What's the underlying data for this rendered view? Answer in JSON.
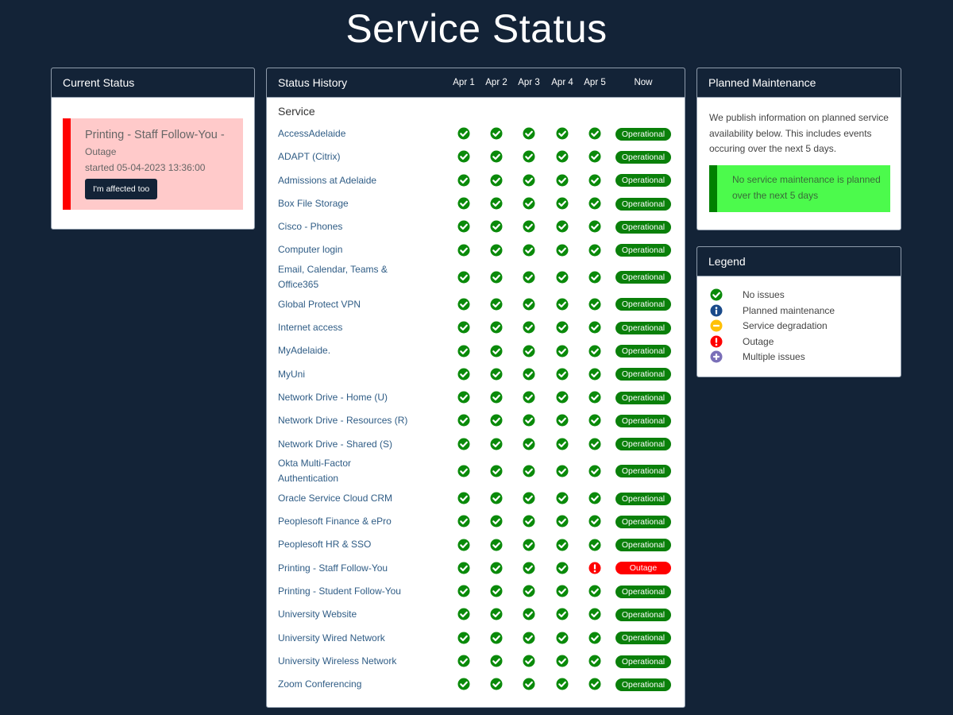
{
  "page": {
    "title": "Service Status"
  },
  "current_status": {
    "header": "Current Status",
    "incident": {
      "title": "Printing - Staff Follow-You -",
      "status": "Outage",
      "started": "started 05-04-2023 13:36:00",
      "button_label": "I'm affected too"
    }
  },
  "history": {
    "header": "Status History",
    "service_label": "Service",
    "columns": [
      "Apr 1",
      "Apr 2",
      "Apr 3",
      "Apr 4",
      "Apr 5"
    ],
    "now_label": "Now",
    "services": [
      {
        "name": "AccessAdelaide",
        "days": [
          "ok",
          "ok",
          "ok",
          "ok",
          "ok"
        ],
        "now": "Operational"
      },
      {
        "name": "ADAPT (Citrix)",
        "days": [
          "ok",
          "ok",
          "ok",
          "ok",
          "ok"
        ],
        "now": "Operational"
      },
      {
        "name": "Admissions at Adelaide",
        "days": [
          "ok",
          "ok",
          "ok",
          "ok",
          "ok"
        ],
        "now": "Operational"
      },
      {
        "name": "Box File Storage",
        "days": [
          "ok",
          "ok",
          "ok",
          "ok",
          "ok"
        ],
        "now": "Operational"
      },
      {
        "name": "Cisco - Phones",
        "days": [
          "ok",
          "ok",
          "ok",
          "ok",
          "ok"
        ],
        "now": "Operational"
      },
      {
        "name": "Computer login",
        "days": [
          "ok",
          "ok",
          "ok",
          "ok",
          "ok"
        ],
        "now": "Operational"
      },
      {
        "name": "Email, Calendar, Teams & Office365",
        "days": [
          "ok",
          "ok",
          "ok",
          "ok",
          "ok"
        ],
        "now": "Operational"
      },
      {
        "name": "Global Protect VPN",
        "days": [
          "ok",
          "ok",
          "ok",
          "ok",
          "ok"
        ],
        "now": "Operational"
      },
      {
        "name": "Internet access",
        "days": [
          "ok",
          "ok",
          "ok",
          "ok",
          "ok"
        ],
        "now": "Operational"
      },
      {
        "name": "MyAdelaide.",
        "days": [
          "ok",
          "ok",
          "ok",
          "ok",
          "ok"
        ],
        "now": "Operational"
      },
      {
        "name": "MyUni",
        "days": [
          "ok",
          "ok",
          "ok",
          "ok",
          "ok"
        ],
        "now": "Operational"
      },
      {
        "name": "Network Drive - Home (U)",
        "days": [
          "ok",
          "ok",
          "ok",
          "ok",
          "ok"
        ],
        "now": "Operational"
      },
      {
        "name": "Network Drive - Resources (R)",
        "days": [
          "ok",
          "ok",
          "ok",
          "ok",
          "ok"
        ],
        "now": "Operational"
      },
      {
        "name": "Network Drive - Shared (S)",
        "days": [
          "ok",
          "ok",
          "ok",
          "ok",
          "ok"
        ],
        "now": "Operational"
      },
      {
        "name": "Okta Multi-Factor Authentication",
        "days": [
          "ok",
          "ok",
          "ok",
          "ok",
          "ok"
        ],
        "now": "Operational"
      },
      {
        "name": "Oracle Service Cloud CRM",
        "days": [
          "ok",
          "ok",
          "ok",
          "ok",
          "ok"
        ],
        "now": "Operational"
      },
      {
        "name": "Peoplesoft Finance & ePro",
        "days": [
          "ok",
          "ok",
          "ok",
          "ok",
          "ok"
        ],
        "now": "Operational"
      },
      {
        "name": "Peoplesoft HR & SSO",
        "days": [
          "ok",
          "ok",
          "ok",
          "ok",
          "ok"
        ],
        "now": "Operational"
      },
      {
        "name": "Printing - Staff Follow-You",
        "days": [
          "ok",
          "ok",
          "ok",
          "ok",
          "outage"
        ],
        "now": "Outage"
      },
      {
        "name": "Printing - Student Follow-You",
        "days": [
          "ok",
          "ok",
          "ok",
          "ok",
          "ok"
        ],
        "now": "Operational"
      },
      {
        "name": "University Website",
        "days": [
          "ok",
          "ok",
          "ok",
          "ok",
          "ok"
        ],
        "now": "Operational"
      },
      {
        "name": "University Wired Network",
        "days": [
          "ok",
          "ok",
          "ok",
          "ok",
          "ok"
        ],
        "now": "Operational"
      },
      {
        "name": "University Wireless Network",
        "days": [
          "ok",
          "ok",
          "ok",
          "ok",
          "ok"
        ],
        "now": "Operational"
      },
      {
        "name": "Zoom Conferencing",
        "days": [
          "ok",
          "ok",
          "ok",
          "ok",
          "ok"
        ],
        "now": "Operational"
      }
    ]
  },
  "maintenance": {
    "header": "Planned Maintenance",
    "description": "We publish information on planned service availability below. This includes events occuring over the next 5 days.",
    "alert": "No service maintenance is planned over the next 5 days"
  },
  "legend": {
    "header": "Legend",
    "items": [
      {
        "icon": "check-circle-icon",
        "kind": "ok",
        "label": "No issues"
      },
      {
        "icon": "info-circle-icon",
        "kind": "info",
        "label": "Planned maintenance"
      },
      {
        "icon": "minus-circle-icon",
        "kind": "degraded",
        "label": "Service degradation"
      },
      {
        "icon": "exclamation-circle-icon",
        "kind": "outage",
        "label": "Outage"
      },
      {
        "icon": "plus-circle-icon",
        "kind": "multiple",
        "label": "Multiple issues"
      }
    ]
  },
  "colors": {
    "ok": "#0a8a0a",
    "info": "#1a4a8a",
    "degraded": "#ffc107",
    "outage": "#ff0000",
    "multiple": "#7a6fb8",
    "operational_badge": "#0a800a",
    "outage_badge": "#ff0000"
  }
}
